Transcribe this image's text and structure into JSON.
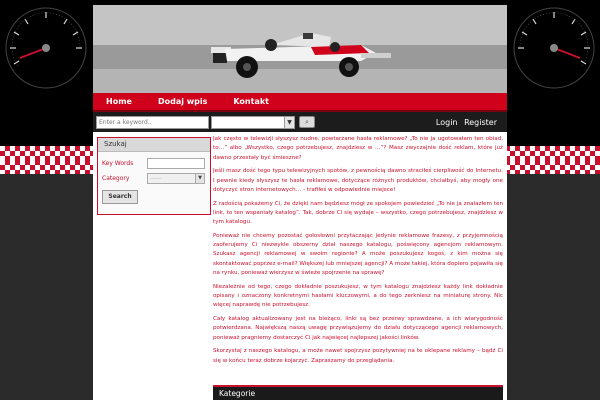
{
  "nav": {
    "items": [
      {
        "label": "Home"
      },
      {
        "label": "Dodaj wpis"
      },
      {
        "label": "Kontakt"
      }
    ]
  },
  "search": {
    "placeholder": "Enter a keyword..",
    "category_value": ""
  },
  "auth": {
    "login": "Login",
    "register": "Register"
  },
  "sidebar": {
    "title": "Szukaj",
    "keywords_label": "Key Words",
    "category_label": "Category",
    "category_value": "--------",
    "search_button": "Search"
  },
  "main": {
    "paragraphs": [
      "Jak często w telewizji słyszysz nudne, powtarzane hasła reklamowe? „To nie ja ugotowałam ten obiad, to…” albo „Wszystko, czego potrzebujesz, znajdziesz w …”? Masz zwyczajnie dość reklam, które już dawno przestały być śmieszne?",
      "Jeśli masz dość tego typu telewizyjnych spotów, z pewnością dawno straciłeś cierpliwość do Internetu. I pewnie kiedy słyszysz te hasła reklamowe, dotyczące różnych produktów, chciałbyś, aby mogły one dotyczyć stron internetowych… - trafiłeś w odpowiednie miejsce!",
      "Z radością pokażemy Ci, że dzięki nam będziesz mógł ze spokojem powiedzieć „To nie ja znalazłem ten link, to ten wspaniały katalog”. Tak, dobrze Ci się wydaje – wszystko, czego potrzebujesz, znajdziesz w tym katalogu.",
      "Ponieważ nie chcemy pozostać gołosłowni przytaczając jedynie reklamowe frazesy, z przyjemnością zaoferujemy Ci niezwykle obszerny dział naszego katalogu, poświęcony agencjom reklamowym. Szukasz agencji reklamowej w swoim regionie? A może poszukujesz kogoś, z kim można się skontaktować poprzez e-mail? Większej lub mniejszej agencji? A może takiej, która dopiero pojawiła się na rynku, ponieważ wierzysz w świeże spojrzenie na sprawę?",
      "Niezależnie od tego, czego dokładnie poszukujesz, w tym katalogu znajdziesz każdy link dokładnie opisany i oznaczony konkretnymi hasłami kluczowymi, a do tego zerkniesz na miniaturę strony. Nic więcej naprawdę nie potrzebujesz.",
      "Cały katalog aktualizowany jest na bieżąco, linki są bez przerwy sprawdzane, a ich wiarygodność potwierdzana. Największą naszą uwagę przywiązujemy do działu dotyczącego agencji reklamowych, ponieważ pragniemy dostarczyć Ci jak najwięcej najlepszej jakości linków.",
      "Skorzystaj z naszego katalogu, a może nawet spojrzysz pozytywniej na te oklepane reklamy – bądź Ci się w końcu teraz dobrze kojarzyć. Zapraszamy do przeglądania."
    ]
  },
  "categories": {
    "title": "Kategorie"
  },
  "colors": {
    "accent": "#c8102e",
    "nav_bg": "#d0021b",
    "page_bg": "#000000"
  }
}
